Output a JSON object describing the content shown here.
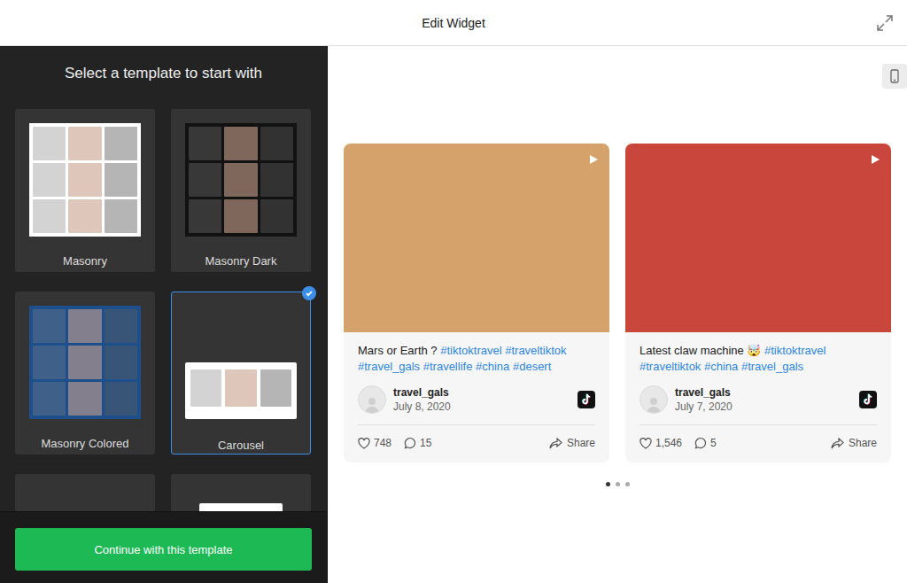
{
  "header": {
    "title": "Edit Widget"
  },
  "templates_panel": {
    "title": "Select a template to start with",
    "templates": [
      {
        "label": "Masonry",
        "selected": false,
        "kind": "masonry",
        "color": "#ffffff"
      },
      {
        "label": "Masonry Dark",
        "selected": false,
        "kind": "masonry",
        "color": "#121212"
      },
      {
        "label": "Masonry Colored",
        "selected": false,
        "kind": "masonry",
        "color": "#1d4f8c"
      },
      {
        "label": "Carousel",
        "selected": true,
        "kind": "carousel",
        "color": "#ffffff"
      },
      {
        "label": "",
        "selected": false,
        "kind": "blank",
        "color": "#343434"
      },
      {
        "label": "",
        "selected": false,
        "kind": "blank",
        "color": "#ffffff"
      }
    ],
    "continue_button": "Continue with this template"
  },
  "preview": {
    "posts": [
      {
        "color": "#d4a26a",
        "caption": [
          {
            "text": "Mars or Earth ?",
            "kind": "text"
          },
          {
            "text": "#tiktoktravel",
            "kind": "hashtag"
          },
          {
            "text": "#traveltiktok",
            "kind": "hashtag"
          },
          {
            "text": "#travel_gals",
            "kind": "hashtag"
          },
          {
            "text": "#travellife",
            "kind": "hashtag"
          },
          {
            "text": "#china",
            "kind": "hashtag"
          },
          {
            "text": "#desert",
            "kind": "hashtag"
          }
        ],
        "author": "travel_gals",
        "date": "July 8, 2020",
        "likes": "748",
        "comments": "15",
        "share": "Share"
      },
      {
        "color": "#c8463c",
        "caption": [
          {
            "text": "Latest claw machine 🤯",
            "kind": "text"
          },
          {
            "text": "#tiktoktravel",
            "kind": "hashtag"
          },
          {
            "text": "#traveltiktok",
            "kind": "hashtag"
          },
          {
            "text": "#china",
            "kind": "hashtag"
          },
          {
            "text": "#travel_gals",
            "kind": "hashtag"
          }
        ],
        "author": "travel_gals",
        "date": "July 7, 2020",
        "likes": "1,546",
        "comments": "5",
        "share": "Share"
      }
    ],
    "dots": [
      {
        "selected": true
      },
      {
        "selected": false
      },
      {
        "selected": false
      }
    ]
  }
}
